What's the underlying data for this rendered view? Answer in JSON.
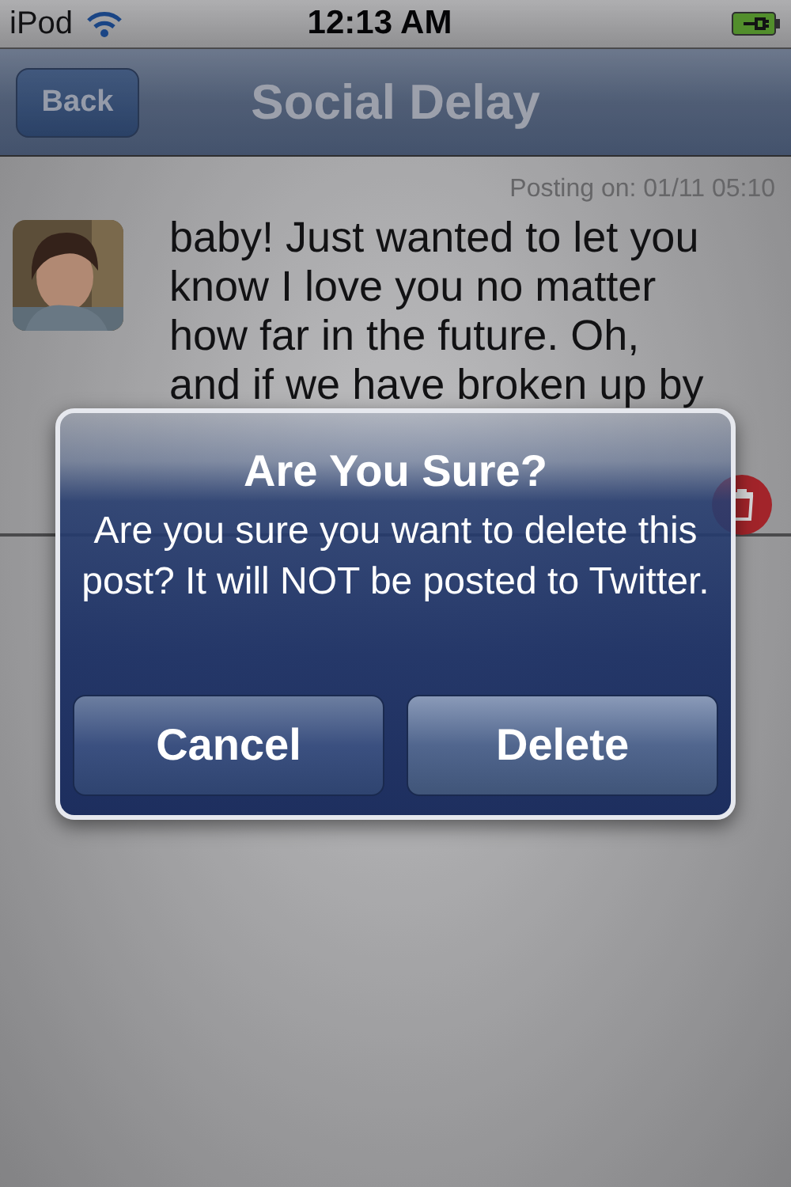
{
  "status_bar": {
    "carrier": "iPod",
    "time": "12:13 AM"
  },
  "nav_bar": {
    "back": "Back",
    "title": "Social Delay"
  },
  "post": {
    "posting_on": "Posting on: 01/11 05:10",
    "text": "baby! Just wanted to let you know I love you no matter how far in the future. Oh, and if we have broken up by"
  },
  "alert": {
    "title": "Are You Sure?",
    "message": "Are you sure you want to delete this post? It will NOT be posted to Twitter.",
    "buttons": [
      {
        "label": "Cancel",
        "kind": "cancel"
      },
      {
        "label": "Delete",
        "kind": "confirm"
      }
    ]
  }
}
